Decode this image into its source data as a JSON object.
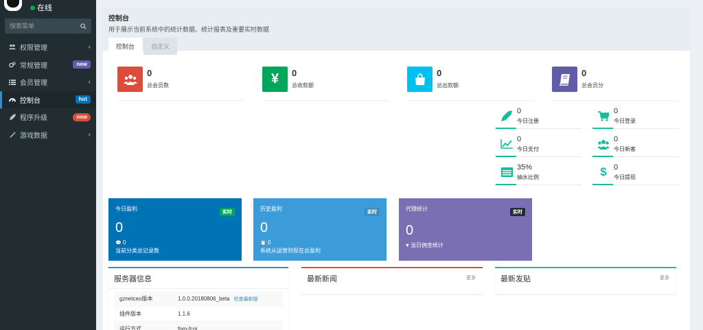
{
  "sidebar": {
    "status": "在线",
    "search_placeholder": "搜索菜单",
    "items": [
      {
        "label": "权限管理",
        "icon": "users-icon",
        "badge": "",
        "chevron": "‹"
      },
      {
        "label": "常规管理",
        "icon": "cogs-icon",
        "badge": "new",
        "chevron": ""
      },
      {
        "label": "会员管理",
        "icon": "list-icon",
        "badge": "",
        "chevron": "‹"
      },
      {
        "label": "控制台",
        "icon": "dashboard-icon",
        "badge": "hot",
        "chevron": ""
      },
      {
        "label": "程序升级",
        "icon": "rocket-icon",
        "badge": "new",
        "chevron": ""
      },
      {
        "label": "游戏数据",
        "icon": "magic-icon",
        "badge": "",
        "chevron": "‹"
      }
    ]
  },
  "header": {
    "title": "控制台",
    "subtitle": "用于展示当前系统中的统计数据、统计报表及重要实时数据",
    "tabs": [
      "控制台",
      "自定义"
    ]
  },
  "stats": [
    {
      "value": "0",
      "label": "总会员数",
      "color": "#dd4b39",
      "icon": "group-icon"
    },
    {
      "value": "0",
      "label": "总收款额",
      "color": "#00a65a",
      "icon": "yen-icon"
    },
    {
      "value": "0",
      "label": "总出款额",
      "color": "#00c0ef",
      "icon": "shopping-bag-icon"
    },
    {
      "value": "0",
      "label": "总会员分",
      "color": "#605ca8",
      "icon": "book-icon"
    }
  ],
  "minis": [
    {
      "value": "0",
      "label": "今日注册",
      "icon": "rocket-icon"
    },
    {
      "value": "0",
      "label": "今日登录",
      "icon": "cart-icon"
    },
    {
      "value": "0",
      "label": "今日支付",
      "icon": "chart-line-icon"
    },
    {
      "value": "0",
      "label": "今日新客",
      "icon": "users-icon"
    },
    {
      "value": "35%",
      "label": "抽水比例",
      "icon": "table-icon"
    },
    {
      "value": "0",
      "label": "今日提现",
      "icon": "dollar-icon"
    }
  ],
  "infoboxes": [
    {
      "title": "今日盈利",
      "badge": "实时",
      "value": "0",
      "meta": "0",
      "desc": "当前分类总记录数",
      "bg": "#0073b7",
      "badge_bg": "#00a65a",
      "meta_icon": "💬"
    },
    {
      "title": "历史盈利",
      "badge": "实时",
      "value": "0",
      "meta": "0",
      "desc": "系统从运营到现在总盈利",
      "bg": "#3c9bd9",
      "badge_bg": "#3c8dbc",
      "meta_icon": "📋"
    },
    {
      "title": "代理统计",
      "badge": "实时",
      "value": "0",
      "meta": "当日佣金统计",
      "desc": "",
      "bg": "#7a6fb3",
      "badge_bg": "#222d32",
      "meta_icon": "♥"
    }
  ],
  "server_box": {
    "title": "服务器信息",
    "rows": [
      {
        "key": "gznetceo版本",
        "value": "1.0.0.20180806_beta",
        "link": "检查最新版"
      },
      {
        "key": "插件版本",
        "value": "1.1.6",
        "link": ""
      },
      {
        "key": "运行方式",
        "value": "fpm-fcgi",
        "link": ""
      }
    ]
  },
  "news_box": {
    "title": "最新新闻",
    "more": "更多"
  },
  "posts_box": {
    "title": "最新发贴",
    "more": "更多"
  }
}
